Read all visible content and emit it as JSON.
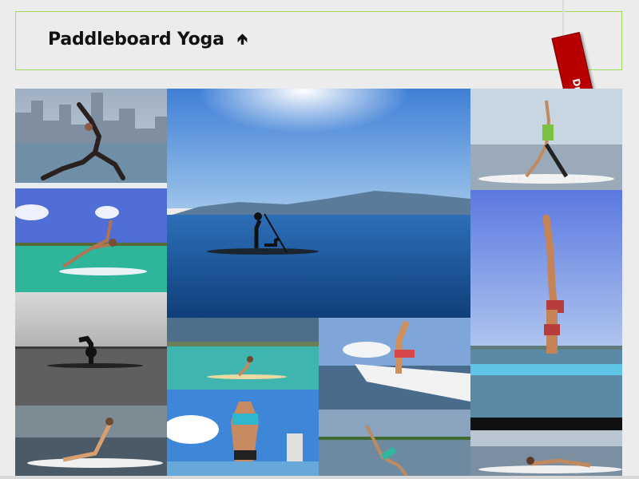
{
  "header": {
    "title": "Paddleboard Yoga",
    "collapse_icon": "arrow-up-icon"
  },
  "ribbon": {
    "label": "Draw down >"
  },
  "gallery": {
    "photos": [
      "crescent-lunge-city-skyline",
      "paddler-with-dog",
      "kneeling-lunge-arms-up",
      "side-plank-tropical",
      "headstand-board-side-view",
      "black-and-white-headstand",
      "seated-pose-turquoise-water",
      "forearm-stand-dock",
      "backbend-sky",
      "seated-twist-black-white",
      "wild-thing-pose-shore",
      "plank-pose-board"
    ]
  }
}
